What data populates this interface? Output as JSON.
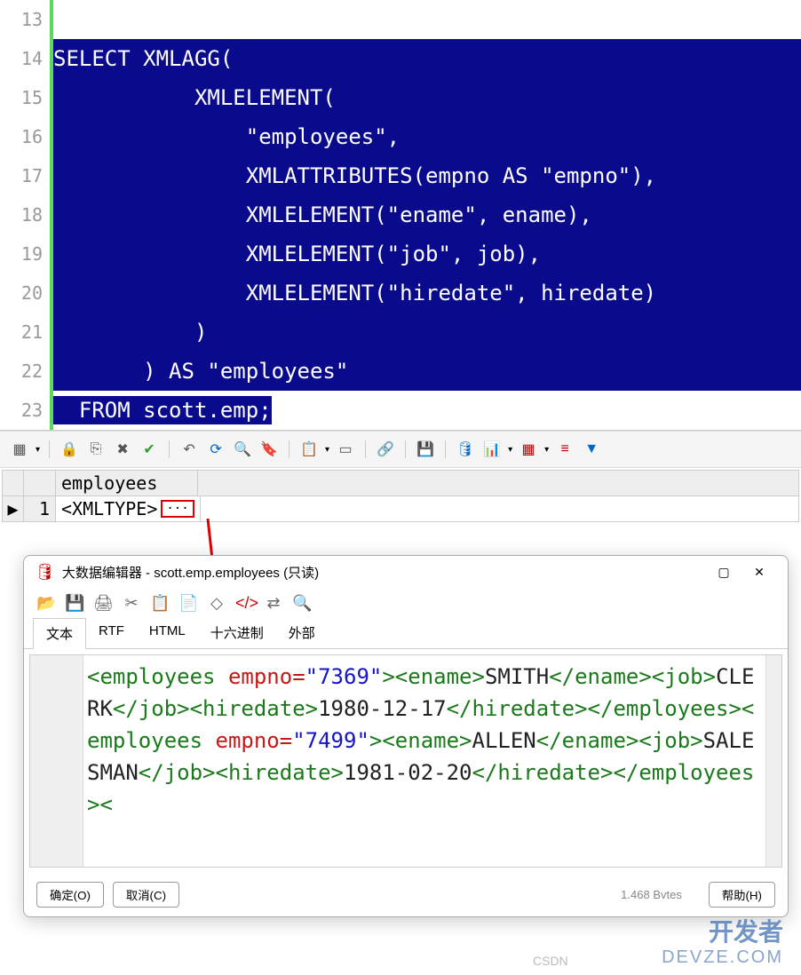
{
  "editor": {
    "lines": [
      {
        "n": 13,
        "text": " "
      },
      {
        "n": 14,
        "text": "SELECT XMLAGG("
      },
      {
        "n": 15,
        "text": "           XMLELEMENT("
      },
      {
        "n": 16,
        "text": "               \"employees\","
      },
      {
        "n": 17,
        "text": "               XMLATTRIBUTES(empno AS \"empno\"),"
      },
      {
        "n": 18,
        "text": "               XMLELEMENT(\"ename\", ename),"
      },
      {
        "n": 19,
        "text": "               XMLELEMENT(\"job\", job),"
      },
      {
        "n": 20,
        "text": "               XMLELEMENT(\"hiredate\", hiredate)"
      },
      {
        "n": 21,
        "text": "           )"
      },
      {
        "n": 22,
        "text": "       ) AS \"employees\""
      },
      {
        "n": 23,
        "text": "  FROM scott.emp;"
      }
    ]
  },
  "grid": {
    "column": "employees",
    "row_num": "1",
    "value": "<XMLTYPE>",
    "ellipsis": "···"
  },
  "dialog": {
    "title": "大数据编辑器 - scott.emp.employees (只读)",
    "tabs": [
      "文本",
      "RTF",
      "HTML",
      "十六进制",
      "外部"
    ],
    "active_tab": 0,
    "xml_tokens": [
      {
        "t": "tag",
        "v": "<employees "
      },
      {
        "t": "attr",
        "v": "empno="
      },
      {
        "t": "val",
        "v": "\"7369\""
      },
      {
        "t": "tag",
        "v": "><ename>"
      },
      {
        "t": "txt",
        "v": "SMITH"
      },
      {
        "t": "tag",
        "v": "</ename"
      },
      {
        "t": "tag",
        "v": "><job>"
      },
      {
        "t": "txt",
        "v": "CLERK"
      },
      {
        "t": "tag",
        "v": "</job><hiredate>"
      },
      {
        "t": "txt",
        "v": "1980-12-17"
      },
      {
        "t": "tag",
        "v": "</"
      },
      {
        "t": "tag",
        "v": "hiredate></employees><employees "
      },
      {
        "t": "attr",
        "v": "empno="
      },
      {
        "t": "val",
        "v": "\"7499"
      },
      {
        "t": "val",
        "v": "\""
      },
      {
        "t": "tag",
        "v": "><ename>"
      },
      {
        "t": "txt",
        "v": "ALLEN"
      },
      {
        "t": "tag",
        "v": "</ename><job>"
      },
      {
        "t": "txt",
        "v": "SALESMAN"
      },
      {
        "t": "tag",
        "v": "</job><"
      },
      {
        "t": "tag",
        "v": "hiredate>"
      },
      {
        "t": "txt",
        "v": "1981-02-20"
      },
      {
        "t": "tag",
        "v": "</hiredate></employees><"
      }
    ],
    "status": "1.468 Bvtes",
    "ok": "确定(O)",
    "cancel": "取消(C)",
    "help": "帮助(H)"
  },
  "watermark": {
    "cn": "开发者",
    "en": "DEVZE.COM",
    "csdn": "CSDN"
  }
}
